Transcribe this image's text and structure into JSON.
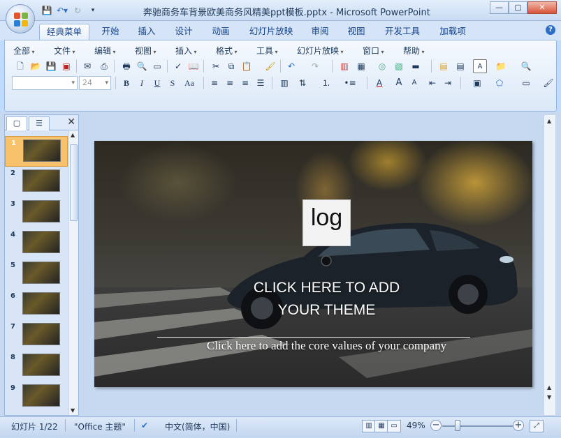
{
  "window": {
    "title": "奔驰商务车背景欧美商务风精美ppt模板.pptx - Microsoft PowerPoint"
  },
  "ribbon_tabs": [
    "经典菜单",
    "开始",
    "插入",
    "设计",
    "动画",
    "幻灯片放映",
    "审阅",
    "视图",
    "开发工具",
    "加载项"
  ],
  "active_tab": "经典菜单",
  "classic_menus": [
    "全部",
    "文件",
    "编辑",
    "视图",
    "插入",
    "格式",
    "工具",
    "幻灯片放映",
    "窗口",
    "帮助"
  ],
  "font_size_box": "24",
  "thumbnails": [
    {
      "num": "1",
      "selected": true
    },
    {
      "num": "2",
      "selected": false
    },
    {
      "num": "3",
      "selected": false
    },
    {
      "num": "4",
      "selected": false
    },
    {
      "num": "5",
      "selected": false
    },
    {
      "num": "6",
      "selected": false
    },
    {
      "num": "7",
      "selected": false
    },
    {
      "num": "8",
      "selected": false
    },
    {
      "num": "9",
      "selected": false
    }
  ],
  "slide": {
    "logo_text": "log",
    "title_line1": "CLICK HERE TO ADD",
    "title_line2": "YOUR THEME",
    "subtitle": "Click here to add the core values of your company"
  },
  "status": {
    "slide_position": "幻灯片 1/22",
    "theme": "\"Office 主题\"",
    "language": "中文(简体，中国)",
    "zoom": "49%",
    "zoom_percent": 49
  }
}
